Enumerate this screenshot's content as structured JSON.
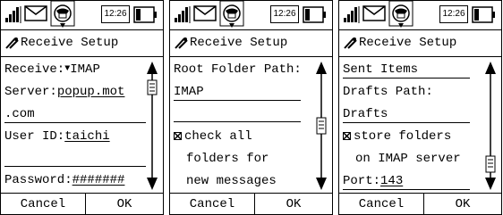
{
  "screens": [
    {
      "status": {
        "time": "12:26"
      },
      "title": "Receive Setup",
      "lines": {
        "receive_label": "Receive:",
        "receive_value": "IMAP",
        "server_label": "Server:",
        "server_value_a": "popup.mot",
        "server_value_b": ".com",
        "userid_label": "User ID:",
        "userid_value": "taichi",
        "password_label": "Password:",
        "password_value": "#######"
      },
      "scroll_position": 0.12,
      "buttons": {
        "cancel": "Cancel",
        "ok": "OK"
      }
    },
    {
      "status": {
        "time": "12:26"
      },
      "title": "Receive Setup",
      "lines": {
        "root_label": "Root Folder Path:",
        "root_value": "IMAP",
        "check_a": "check all",
        "check_b": "folders for",
        "check_c": "new messages"
      },
      "check_all_checked": true,
      "scroll_position": 0.5,
      "buttons": {
        "cancel": "Cancel",
        "ok": "OK"
      }
    },
    {
      "status": {
        "time": "12:26"
      },
      "title": "Receive Setup",
      "lines": {
        "sent_value": "Sent Items",
        "drafts_label": "Drafts Path:",
        "drafts_value": "Drafts",
        "store_a": "store folders",
        "store_b": "on IMAP server",
        "port_label": "Port:",
        "port_value": "143"
      },
      "store_checked": true,
      "scroll_position": 0.88,
      "buttons": {
        "cancel": "Cancel",
        "ok": "OK"
      }
    }
  ]
}
